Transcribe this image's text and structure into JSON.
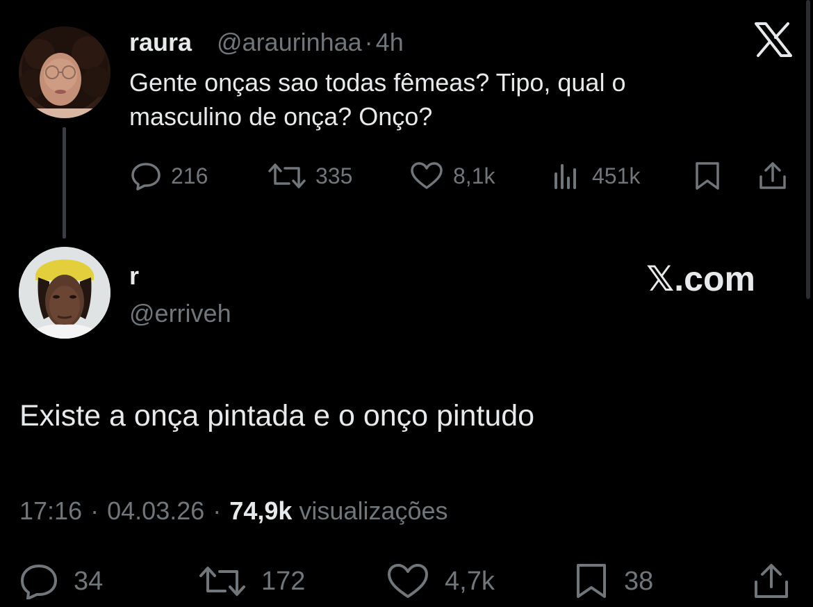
{
  "quoted_tweet": {
    "display_name": "raura",
    "handle": "@araurinhaa",
    "separator": "·",
    "time": "4h",
    "text_line1": "Gente onças sao todas fêmeas? Tipo, qual o",
    "text_line2": "masculino de onça? Onço?",
    "replies": "216",
    "reposts": "335",
    "likes": "8,1k",
    "views": "451k",
    "platform_icon": "x-logo-icon"
  },
  "reply_tweet": {
    "display_name": "r",
    "handle": "@erriveh",
    "watermark": "𝕏.com",
    "text": "Existe a onça pintada e o onço pintudo",
    "time": "17:16",
    "sep1": "·",
    "date": "04.03.26",
    "sep2": "·",
    "views_count": "74,9k",
    "views_label": "visualizações",
    "replies": "34",
    "reposts": "172",
    "likes": "4,7k",
    "bookmarks": "38"
  },
  "colors": {
    "background": "#000000",
    "text_primary": "#e7e9ea",
    "text_secondary": "#71767b"
  }
}
